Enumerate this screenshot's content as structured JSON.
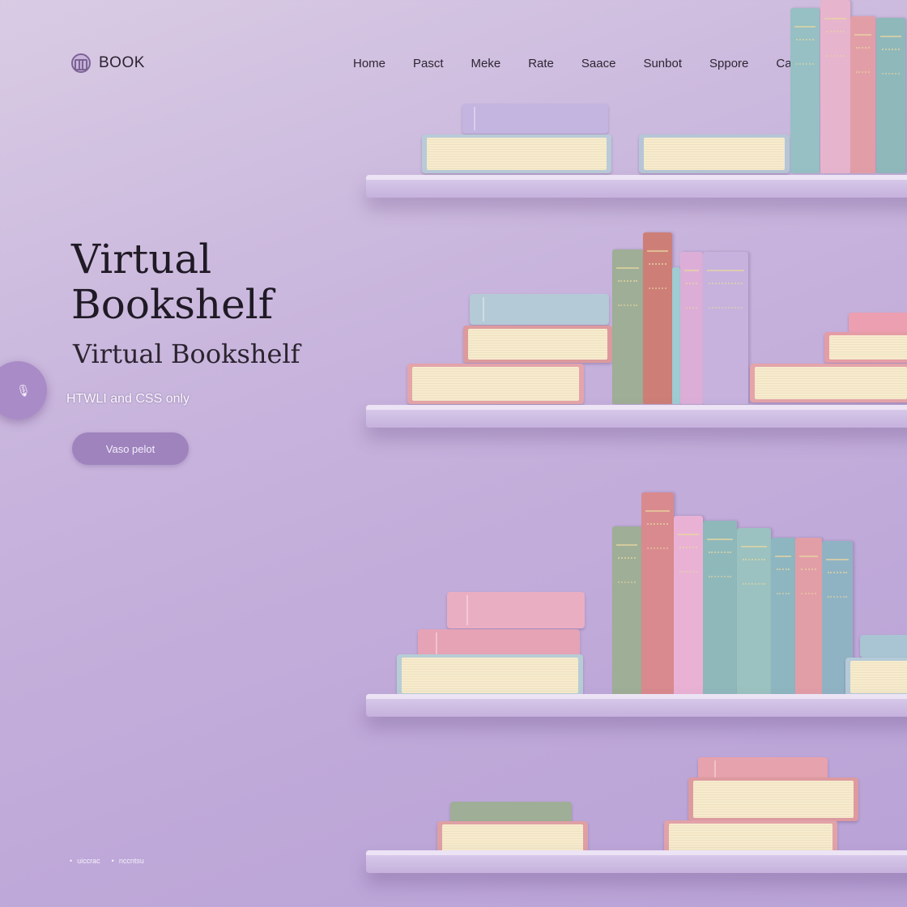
{
  "brand": {
    "name": "BOOK",
    "icon": "book-logo-icon"
  },
  "nav": {
    "items": [
      {
        "label": "Home"
      },
      {
        "label": "Pasct"
      },
      {
        "label": "Meke"
      },
      {
        "label": "Rate"
      },
      {
        "label": "Saace"
      },
      {
        "label": "Sunbot"
      },
      {
        "label": "Sppore"
      },
      {
        "label": "Catings"
      }
    ]
  },
  "hero": {
    "title": "Virtual Bookshelf",
    "subtitle": "Virtual Bookshelf",
    "caption": "HTWLI and CSS only",
    "cta_label": "Vaso pelot"
  },
  "side_handle": {
    "icon": "microphone-icon"
  },
  "footer": {
    "links": [
      {
        "label": "uiccrac"
      },
      {
        "label": "nccntsu"
      }
    ]
  },
  "colors": {
    "background": "#c7b3dc",
    "accent": "#9e83bd",
    "shelf": "#d6c7e8",
    "book_pink": "#e8aebf",
    "book_rose": "#d98a8e",
    "book_teal": "#8fb8bb",
    "book_sage": "#9fae96",
    "book_lilac": "#c6b2dd",
    "book_blue": "#a9bfcf"
  }
}
